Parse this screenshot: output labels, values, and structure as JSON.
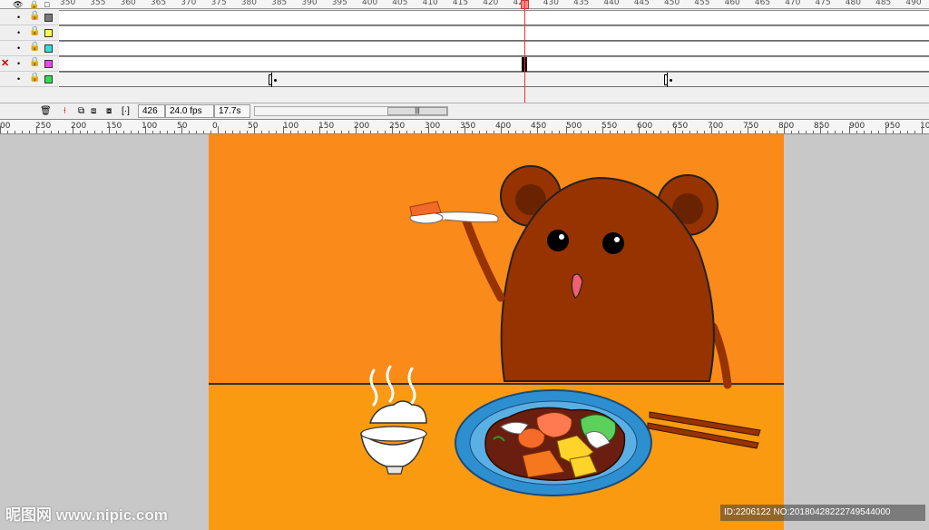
{
  "timeline": {
    "frame_numbers": [
      "350",
      "355",
      "360",
      "365",
      "370",
      "375",
      "380",
      "385",
      "390",
      "395",
      "400",
      "405",
      "410",
      "415",
      "420",
      "425",
      "430",
      "435",
      "440",
      "445",
      "450",
      "455",
      "460",
      "465",
      "470",
      "475",
      "480",
      "485",
      "490"
    ],
    "layers": [
      {
        "color": "#7a7a7a",
        "active": false
      },
      {
        "color": "#ffff44",
        "active": false
      },
      {
        "color": "#33dddd",
        "active": false
      },
      {
        "color": "#ee44ee",
        "active": true
      },
      {
        "color": "#33dd55",
        "active": false
      }
    ],
    "status": {
      "current_frame": "426",
      "frame_rate": "24.0 fps",
      "elapsed": "17.7s"
    }
  },
  "stage_ruler": {
    "labels": [
      "00",
      "250",
      "200",
      "150",
      "100",
      "50",
      "0",
      "50",
      "100",
      "150",
      "200",
      "250",
      "300",
      "350",
      "400",
      "450",
      "500",
      "550",
      "600",
      "650",
      "700",
      "750",
      "800",
      "850",
      "900",
      "950",
      "1000"
    ]
  },
  "watermark": {
    "site": "昵图网 www.nipic.com",
    "id_text": "ID:2206122 NO:20180428222749544000"
  },
  "colors": {
    "stage_wall": "#fa8a1a",
    "stage_table": "#f99a10",
    "bear_body": "#973300",
    "plate": "#2e8fd0",
    "playhead": "#e33333"
  }
}
